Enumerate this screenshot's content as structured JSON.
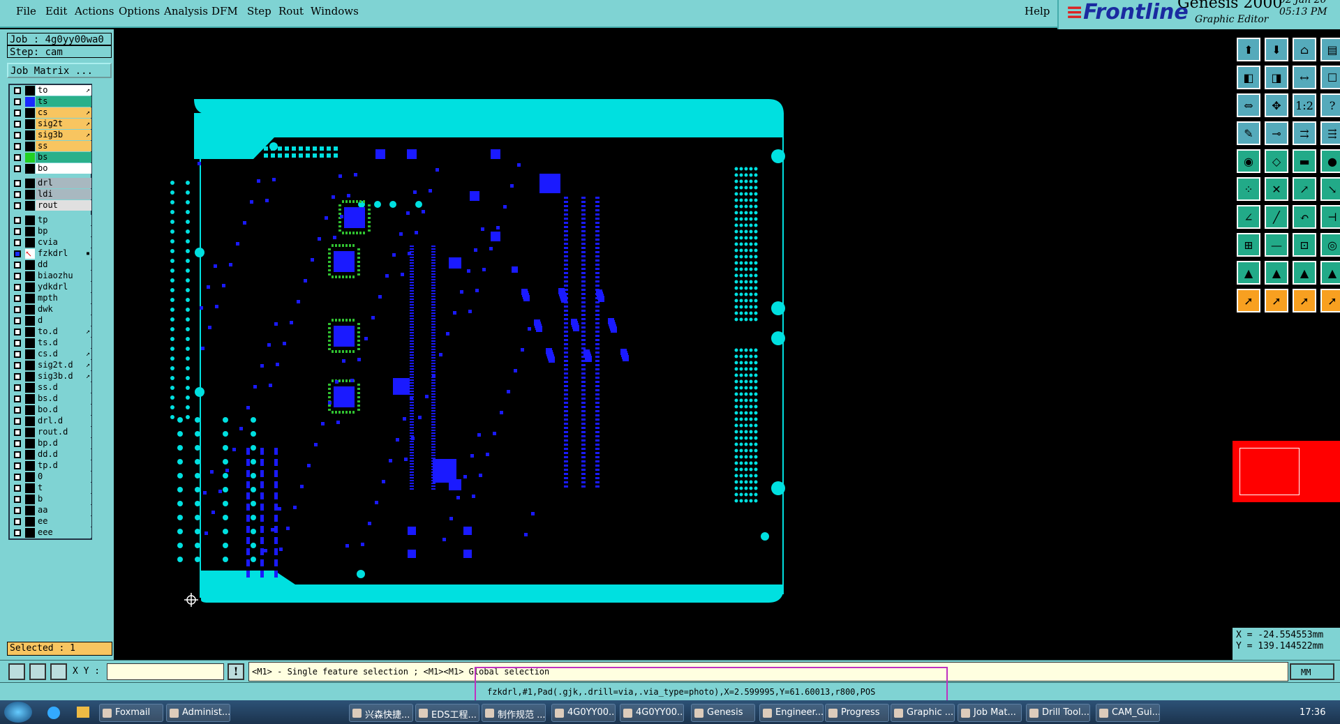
{
  "menu": {
    "file": "File",
    "edit": "Edit",
    "actions": "Actions",
    "options": "Options",
    "analysis": "Analysis",
    "dfm": "DFM",
    "step": "Step",
    "rout": "Rout",
    "windows": "Windows",
    "help": "Help"
  },
  "brand": {
    "logo": "Frontline",
    "app": "Genesis 2000",
    "subtitle": "Graphic Editor",
    "date": "02 Jan 20",
    "time": "05:13 PM"
  },
  "job": {
    "job": "Job : 4g0yy00wa0",
    "step": "Step: cam",
    "matrix": "Job Matrix ..."
  },
  "layers": [
    {
      "name": "to",
      "color": "#ffffff",
      "mark": "↗"
    },
    {
      "name": "ts",
      "color": "#2ab08a",
      "mark": ""
    },
    {
      "name": "cs",
      "color": "#f8c560",
      "mark": "↗"
    },
    {
      "name": "sig2t",
      "color": "#f8c560",
      "mark": "↗"
    },
    {
      "name": "sig3b",
      "color": "#f8c560",
      "mark": "↗"
    },
    {
      "name": "ss",
      "color": "#f8c560",
      "mark": ""
    },
    {
      "name": "bs",
      "color": "#2ab08a",
      "mark": ""
    },
    {
      "name": "bo",
      "color": "#ffffff",
      "mark": ""
    },
    {
      "name": "drl",
      "color": "#a8b8c0",
      "mark": ""
    },
    {
      "name": "ldi",
      "color": "#a8b8c0",
      "mark": ""
    },
    {
      "name": "rout",
      "color": "#e0e0e0",
      "mark": ""
    },
    {
      "name": "tp",
      "color": "#7fd3d3",
      "mark": ""
    },
    {
      "name": "bp",
      "color": "#7fd3d3",
      "mark": ""
    },
    {
      "name": "cvia",
      "color": "#7fd3d3",
      "mark": ""
    },
    {
      "name": "fzkdrl",
      "color": "#7fd3d3",
      "mark": "▪"
    },
    {
      "name": "dd",
      "color": "#7fd3d3",
      "mark": ""
    },
    {
      "name": "biaozhu",
      "color": "#7fd3d3",
      "mark": ""
    },
    {
      "name": "ydkdrl",
      "color": "#7fd3d3",
      "mark": ""
    },
    {
      "name": "mpth",
      "color": "#7fd3d3",
      "mark": ""
    },
    {
      "name": "dwk",
      "color": "#7fd3d3",
      "mark": ""
    },
    {
      "name": "d",
      "color": "#7fd3d3",
      "mark": ""
    },
    {
      "name": "to.d",
      "color": "#7fd3d3",
      "mark": "↗"
    },
    {
      "name": "ts.d",
      "color": "#7fd3d3",
      "mark": ""
    },
    {
      "name": "cs.d",
      "color": "#7fd3d3",
      "mark": "↗"
    },
    {
      "name": "sig2t.d",
      "color": "#7fd3d3",
      "mark": "↗"
    },
    {
      "name": "sig3b.d",
      "color": "#7fd3d3",
      "mark": "↗"
    },
    {
      "name": "ss.d",
      "color": "#7fd3d3",
      "mark": ""
    },
    {
      "name": "bs.d",
      "color": "#7fd3d3",
      "mark": ""
    },
    {
      "name": "bo.d",
      "color": "#7fd3d3",
      "mark": ""
    },
    {
      "name": "drl.d",
      "color": "#7fd3d3",
      "mark": ""
    },
    {
      "name": "rout.d",
      "color": "#7fd3d3",
      "mark": ""
    },
    {
      "name": "bp.d",
      "color": "#7fd3d3",
      "mark": ""
    },
    {
      "name": "dd.d",
      "color": "#7fd3d3",
      "mark": ""
    },
    {
      "name": "tp.d",
      "color": "#7fd3d3",
      "mark": ""
    },
    {
      "name": "0",
      "color": "#7fd3d3",
      "mark": ""
    },
    {
      "name": "t",
      "color": "#7fd3d3",
      "mark": ""
    },
    {
      "name": "b",
      "color": "#7fd3d3",
      "mark": ""
    },
    {
      "name": "aa",
      "color": "#7fd3d3",
      "mark": ""
    },
    {
      "name": "ee",
      "color": "#7fd3d3",
      "mark": ""
    },
    {
      "name": "eee",
      "color": "#7fd3d3",
      "mark": ""
    }
  ],
  "selected": "Selected : 1",
  "coords": {
    "x": "X = -24.554553mm",
    "y": "Y = 139.144522mm"
  },
  "cmd": {
    "xy_label": "X Y :",
    "xy_value": "",
    "hint": "<M1> - Single feature selection ; <M1><M1> Global selection",
    "unit": "MM"
  },
  "status": "fzkdrl,#1,Pad(.gjk,.drill=via,.via_type=photo),X=2.599995,Y=61.60013,r800,POS",
  "taskbar": {
    "time": "17:36",
    "items": [
      "Foxmail",
      "Administ...",
      "兴森快捷...",
      "EDS工程...",
      "制作规范 ...",
      "4G0YY00...",
      "4G0YY00...",
      "Genesis",
      "Engineer...",
      "Progress",
      "Graphic ...",
      "Job Mat...",
      "Drill Tool...",
      "CAM_Gui..."
    ]
  },
  "colors": {
    "board": "#00e0e0",
    "feature": "#1a1aff",
    "panel": "#7fd3d3",
    "pad_ring": "#30c030"
  }
}
